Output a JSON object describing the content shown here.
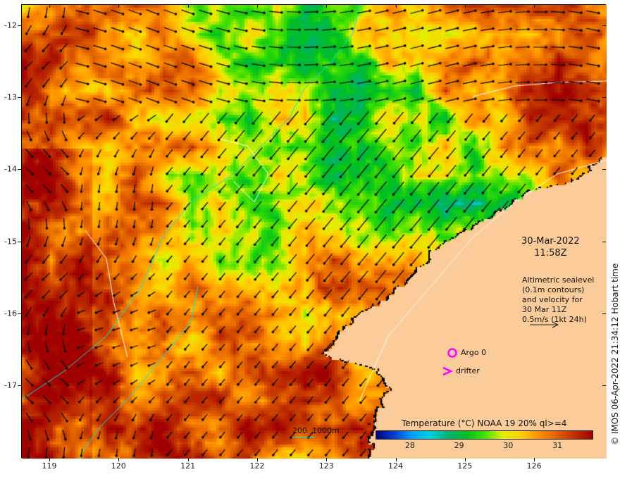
{
  "map": {
    "x_ticks": [
      "119",
      "120",
      "121",
      "122",
      "123",
      "124",
      "125",
      "126"
    ],
    "y_ticks": [
      "-12",
      "-13",
      "-14",
      "-15",
      "-16",
      "-17"
    ],
    "date": "30-Mar-2022",
    "time": "11:58Z",
    "legend_lines": [
      "Altimetric sealevel",
      "(0.1m contours)",
      "and velocity for",
      "30 Mar 11Z",
      "0.5m/s (1kt 24h)"
    ],
    "argo_label": "Argo 0",
    "drifter_label": "drifter",
    "scale_label": "200  1000m",
    "colorbar_title": "Temperature (°C) NOAA 19 20% ql>=4",
    "colorbar_ticks": [
      "28",
      "29",
      "30",
      "31"
    ],
    "colorbar_range": [
      27.3,
      31.7
    ],
    "credit": "© IMOS 06-Apr-2022 21:34:12 Hobart time",
    "colors": {
      "land": "#fccb9a",
      "marker": "#ff00ff",
      "contour_200": "#00e5ee",
      "contour_1000": "#ffffff"
    }
  }
}
